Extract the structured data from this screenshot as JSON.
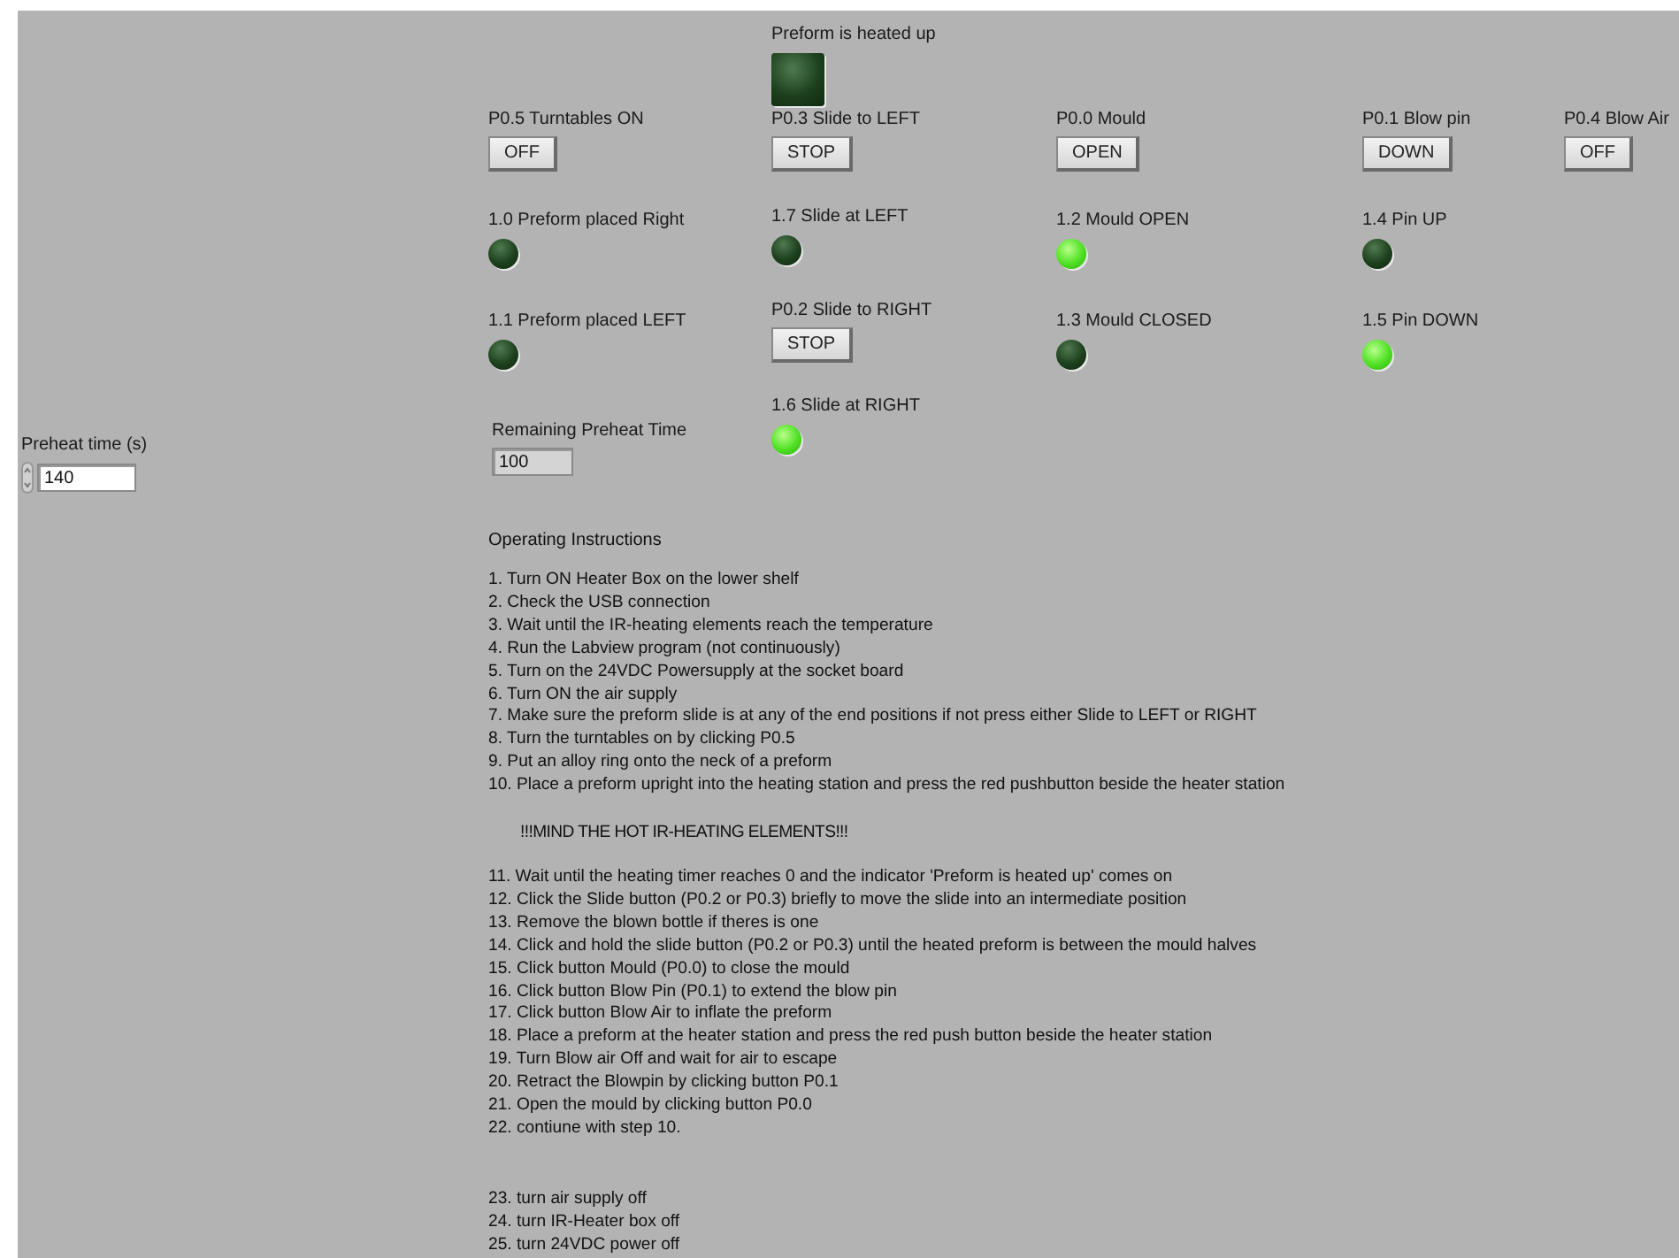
{
  "controls": [
    {
      "kind": "square_led",
      "label": "Preform is heated up",
      "on": false
    },
    {
      "kind": "button",
      "label": "P0.5 Turntables ON",
      "text": "OFF"
    },
    {
      "kind": "button",
      "label": "P0.3 Slide to LEFT",
      "text": "STOP"
    },
    {
      "kind": "button",
      "label": "P0.0 Mould",
      "text": "OPEN"
    },
    {
      "kind": "button",
      "label": "P0.1 Blow pin",
      "text": "DOWN"
    },
    {
      "kind": "button",
      "label": "P0.4 Blow Air",
      "text": "OFF"
    },
    {
      "kind": "led",
      "label": "1.0 Preform placed Right",
      "on": false
    },
    {
      "kind": "led",
      "label": "1.7 Slide at LEFT",
      "on": false
    },
    {
      "kind": "led",
      "label": "1.2 Mould OPEN",
      "on": true
    },
    {
      "kind": "led",
      "label": "1.4 Pin UP",
      "on": false
    },
    {
      "kind": "led",
      "label": "1.1 Preform placed LEFT",
      "on": false
    },
    {
      "kind": "button",
      "label": "P0.2 Slide to RIGHT",
      "text": "STOP"
    },
    {
      "kind": "led",
      "label": "1.3 Mould CLOSED",
      "on": false
    },
    {
      "kind": "led",
      "label": "1.5 Pin DOWN",
      "on": true
    },
    {
      "kind": "led",
      "label": "1.6 Slide at RIGHT",
      "on": true
    },
    {
      "kind": "indicator",
      "label": "Remaining Preheat Time",
      "text": "100"
    },
    {
      "kind": "numeric",
      "label": "Preheat time (s)",
      "text": "140"
    }
  ],
  "instructions": {
    "title": "Operating Instructions",
    "groups": [
      {
        "kind": "steps",
        "lines": [
          "1. Turn ON Heater Box on the lower shelf",
          "2. Check the USB connection",
          "3. Wait until the IR-heating elements reach the temperature",
          "4. Run the Labview program (not continuously)",
          "5. Turn on the 24VDC Powersupply at the socket board",
          "6. Turn ON the air supply",
          "7. Make sure the preform slide is at any of the end positions if not press either Slide to LEFT or RIGHT",
          "8. Turn the turntables on by clicking P0.5",
          "9. Put an alloy ring onto the neck of a preform",
          "10. Place a preform upright into the heating station and press the red pushbutton beside the heater station"
        ]
      },
      {
        "kind": "warning",
        "lines": [
          "!!!MIND THE HOT IR-HEATING ELEMENTS!!!"
        ]
      },
      {
        "kind": "steps",
        "lines": [
          "11. Wait until the heating timer reaches 0 and the indicator 'Preform is heated up' comes on",
          "12. Click the Slide button (P0.2 or P0.3) briefly to move the slide into an intermediate position",
          "13. Remove the blown bottle if theres is one",
          "14. Click and hold the slide button (P0.2 or P0.3) until the heated preform is between the mould halves",
          "15. Click button Mould (P0.0) to close the mould",
          "16. Click button Blow Pin (P0.1) to extend the blow pin",
          "17. Click button Blow Air to inflate the preform",
          "18. Place a preform at the heater station and press the red push button beside the heater station",
          "19. Turn Blow air Off and wait for air to escape",
          "20. Retract the Blowpin by clicking button P0.1",
          "21. Open the mould by clicking button P0.0",
          "22. contiune with step 10."
        ]
      },
      {
        "kind": "steps",
        "lines": [
          "23. turn air supply off",
          "24. turn IR-Heater box off",
          "25. turn 24VDC power off"
        ]
      }
    ]
  }
}
